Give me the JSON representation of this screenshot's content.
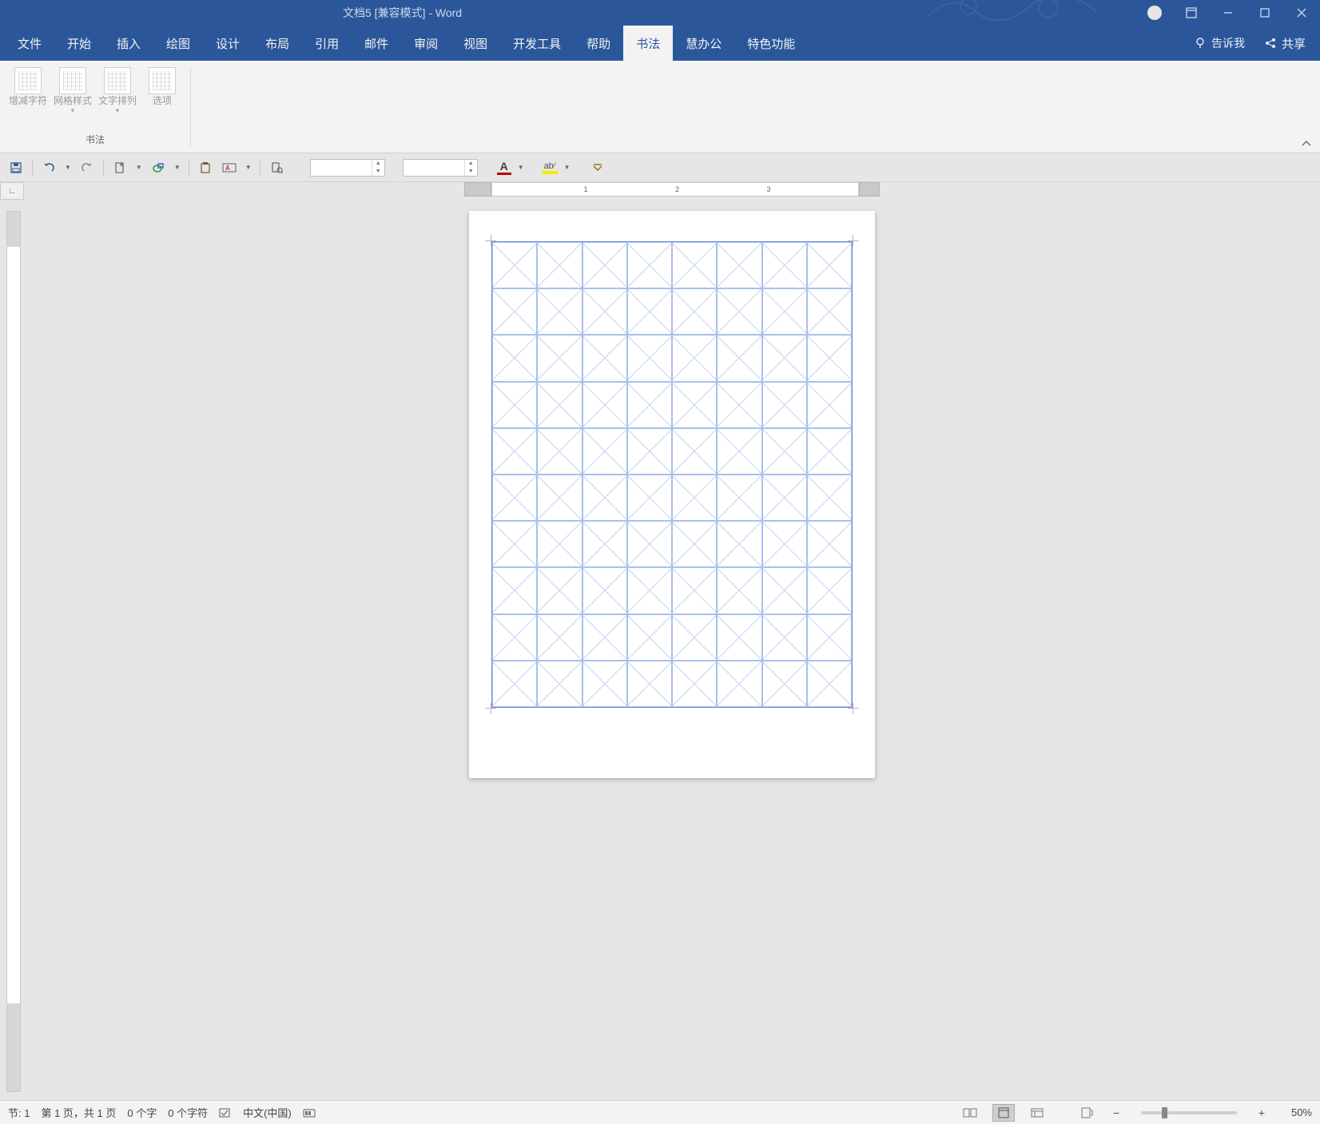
{
  "title": "文档5 [兼容模式] - Word",
  "tabs": [
    "文件",
    "开始",
    "插入",
    "绘图",
    "设计",
    "布局",
    "引用",
    "邮件",
    "审阅",
    "视图",
    "开发工具",
    "帮助",
    "书法",
    "慧办公",
    "特色功能"
  ],
  "active_tab_index": 12,
  "tellme": "告诉我",
  "share": "共享",
  "ribbon": {
    "group_name": "书法",
    "btns": [
      {
        "label": "增减字符",
        "dropdown": false
      },
      {
        "label": "网格样式",
        "dropdown": true
      },
      {
        "label": "文字排列",
        "dropdown": true
      },
      {
        "label": "选项",
        "dropdown": false
      }
    ]
  },
  "hruler_ticks": [
    "1",
    "2",
    "3"
  ],
  "grid": {
    "cols": 8,
    "rows": 10
  },
  "status": {
    "section": "节: 1",
    "page": "第 1 页，共 1 页",
    "words": "0 个字",
    "chars": "0 个字符",
    "lang": "中文(中国)",
    "zoom": "50%",
    "zoom_ratio": 0.22
  }
}
